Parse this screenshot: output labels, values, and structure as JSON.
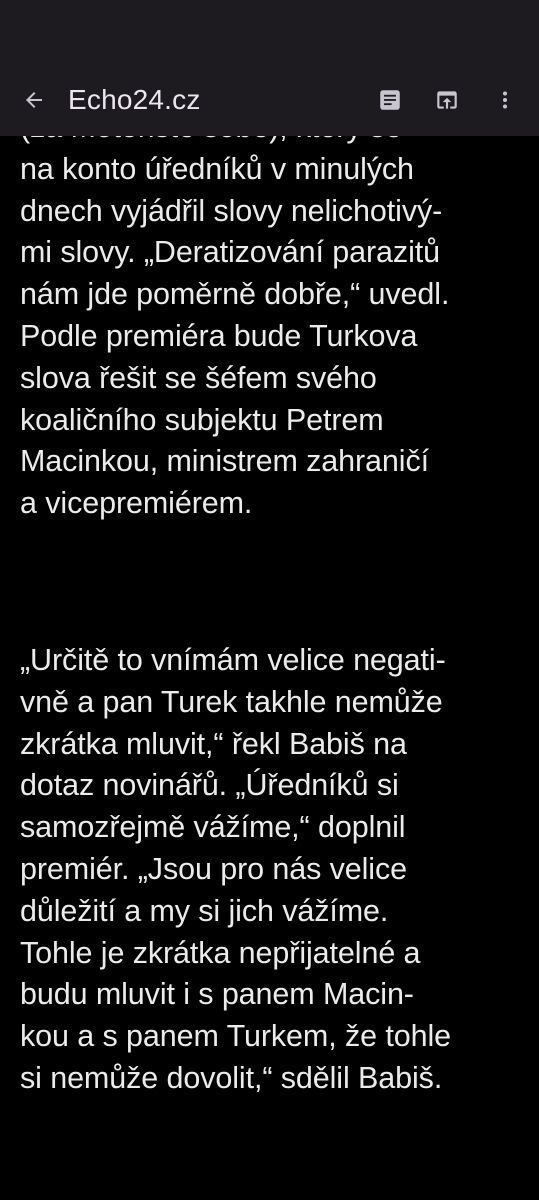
{
  "app_bar": {
    "title": "Echo24.cz",
    "back_icon": "arrow-left-icon",
    "actions": [
      {
        "name": "reader-mode-icon"
      },
      {
        "name": "open-in-app-icon"
      },
      {
        "name": "more-vert-icon"
      }
    ]
  },
  "colors": {
    "app_bar_bg": "#1d1b20",
    "page_bg": "#000000",
    "text": "#ebebeb",
    "icon": "#c9c5cf"
  },
  "article": {
    "paragraph1": [
      "(za Motoristé sobě), který se",
      "na konto úředníků v minulých",
      "dnech vyjádřil slovy nelichotivý-",
      "mi slovy. „Deratizování parazitů",
      "nám jde poměrně dobře,“ uvedl.",
      "Podle premiéra bude Turkova",
      "slova řešit se šéfem svého",
      "koaličního subjektu Petrem",
      "Macinkou, ministrem zahraničí",
      "a vicepremiérem."
    ],
    "paragraph2": [
      "„Určitě to vnímám velice negati-",
      "vně a pan Turek takhle nemůže",
      "zkrátka mluvit,“ řekl Babiš na",
      "dotaz novinářů. „Úředníků si",
      "samozřejmě vážíme,“ doplnil",
      "premiér. „Jsou pro nás velice",
      "důležití a my si jich vážíme.",
      "Tohle je zkrátka nepřijatelné a",
      "budu mluvit i s panem Macin-",
      "kou a s panem Turkem, že tohle",
      "si nemůže dovolit,“ sdělil Babiš."
    ]
  }
}
